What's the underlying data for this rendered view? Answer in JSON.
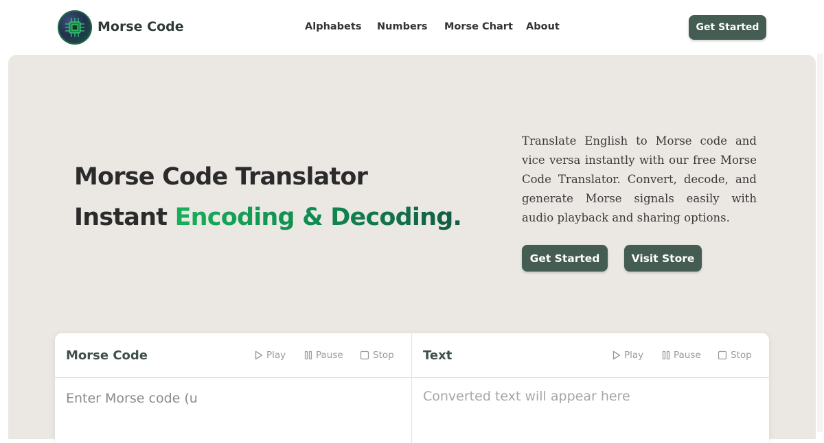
{
  "header": {
    "brand": "Morse Code",
    "nav": [
      {
        "label": "Alphabets"
      },
      {
        "label": "Numbers"
      },
      {
        "label": "Morse Chart"
      },
      {
        "label": "About"
      }
    ],
    "cta_label": "Get Started"
  },
  "hero": {
    "title_line1": "Morse Code Translator",
    "title_line2_prefix": "Instant ",
    "title_line2_highlight": "Encoding & Decoding.",
    "description": "Translate English to Morse code and vice versa instantly with our free Morse Code Translator. Convert, decode, and generate Morse signals easily with audio playback and sharing options.",
    "buttons": {
      "get_started": "Get Started",
      "visit_store": "Visit Store"
    }
  },
  "translator": {
    "morse": {
      "title": "Morse Code",
      "play": "Play",
      "pause": "Pause",
      "stop": "Stop",
      "input_value": "Enter Morse code (u"
    },
    "text": {
      "title": "Text",
      "play": "Play",
      "pause": "Pause",
      "stop": "Stop",
      "placeholder": "Converted text will appear here"
    }
  },
  "colors": {
    "accent": "#445c52",
    "hero_bg": "#ebe8e4",
    "highlight_start": "#17b05a",
    "highlight_end": "#135a45"
  },
  "icons": {
    "logo": "circuit-chip-icon",
    "play": "play-icon",
    "pause": "pause-icon",
    "stop": "stop-icon"
  }
}
